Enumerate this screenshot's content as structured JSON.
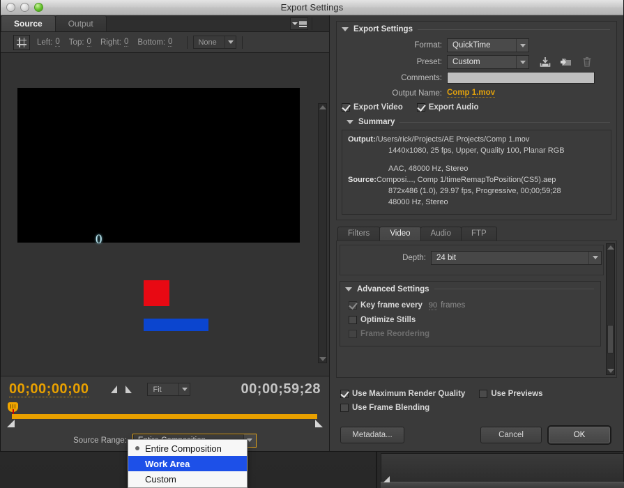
{
  "window": {
    "title": "Export Settings"
  },
  "left": {
    "tabs": [
      {
        "label": "Source",
        "active": true
      },
      {
        "label": "Output",
        "active": false
      }
    ],
    "crop": {
      "left_label": "Left:",
      "left_value": "0",
      "top_label": "Top:",
      "top_value": "0",
      "right_label": "Right:",
      "right_value": "0",
      "bottom_label": "Bottom:",
      "bottom_value": "0",
      "ratio_value": "None"
    },
    "preview": {
      "glyph": "0"
    },
    "transport": {
      "current_time": "00;00;00;00",
      "duration": "00;00;59;28",
      "zoom_level": "Fit"
    },
    "source_range": {
      "label": "Source Range:",
      "value": "Entire Composition",
      "options": [
        {
          "label": "Entire Composition",
          "selected": true,
          "highlighted": false
        },
        {
          "label": "Work Area",
          "selected": false,
          "highlighted": true
        },
        {
          "label": "Custom",
          "selected": false,
          "highlighted": false
        }
      ]
    }
  },
  "right": {
    "export_settings": {
      "title": "Export Settings",
      "format_label": "Format:",
      "format_value": "QuickTime",
      "preset_label": "Preset:",
      "preset_value": "Custom",
      "comments_label": "Comments:",
      "comments_value": "",
      "output_name_label": "Output Name:",
      "output_name_value": "Comp 1.mov",
      "export_video_label": "Export Video",
      "export_video_checked": true,
      "export_audio_label": "Export Audio",
      "export_audio_checked": true
    },
    "summary": {
      "title": "Summary",
      "output_key": "Output:",
      "output_lines": [
        "/Users/rick/Projects/AE Projects/Comp 1.mov",
        "1440x1080, 25 fps, Upper, Quality 100, Planar RGB",
        "",
        "AAC, 48000 Hz, Stereo"
      ],
      "source_key": "Source:",
      "source_lines": [
        "Composi..., Comp 1/timeRemapToPosition(CS5).aep",
        "872x486 (1.0), 29.97 fps, Progressive, 00;00;59;28",
        "48000 Hz, Stereo"
      ]
    },
    "codec_tabs": [
      {
        "label": "Filters",
        "active": false
      },
      {
        "label": "Video",
        "active": true
      },
      {
        "label": "Audio",
        "active": false
      },
      {
        "label": "FTP",
        "active": false
      }
    ],
    "video_tab": {
      "depth_label": "Depth:",
      "depth_value": "24 bit",
      "advanced_title": "Advanced Settings",
      "keyframe_label": "Key frame every",
      "keyframe_value": "90",
      "keyframe_unit": "frames",
      "keyframe_checked": true,
      "optimize_stills_label": "Optimize Stills",
      "optimize_stills_checked": false,
      "frame_reordering_label": "Frame Reordering",
      "frame_reordering_checked": false
    },
    "bottom_checks": {
      "max_render_label": "Use Maximum Render Quality",
      "max_render_checked": true,
      "use_previews_label": "Use Previews",
      "use_previews_checked": false,
      "frame_blending_label": "Use Frame Blending",
      "frame_blending_checked": false
    },
    "footer": {
      "metadata_label": "Metadata...",
      "cancel_label": "Cancel",
      "ok_label": "OK"
    }
  },
  "colors": {
    "accent_orange": "#e8a000",
    "link_orange": "#e2a10c",
    "highlight_blue": "#1d50e8",
    "preview_red": "#e80913",
    "preview_blue": "#0b45cf",
    "preview_cyan": "#bfe8f2"
  }
}
